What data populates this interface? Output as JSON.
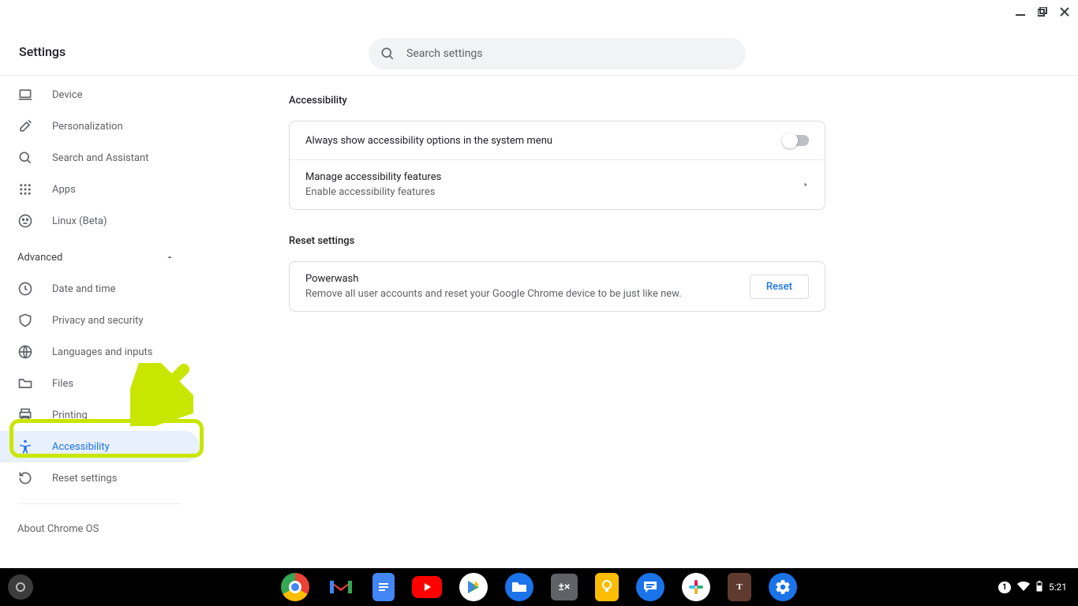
{
  "window": {
    "title": "Settings"
  },
  "search": {
    "placeholder": "Search settings"
  },
  "sidebar": {
    "main_items": [
      {
        "icon": "laptop",
        "label": "Device"
      },
      {
        "icon": "brush",
        "label": "Personalization"
      },
      {
        "icon": "search",
        "label": "Search and Assistant"
      },
      {
        "icon": "apps",
        "label": "Apps"
      },
      {
        "icon": "linux",
        "label": "Linux (Beta)"
      }
    ],
    "advanced_label": "Advanced",
    "advanced_items": [
      {
        "icon": "clock",
        "label": "Date and time"
      },
      {
        "icon": "shield",
        "label": "Privacy and security"
      },
      {
        "icon": "globe",
        "label": "Languages and inputs"
      },
      {
        "icon": "folder",
        "label": "Files"
      },
      {
        "icon": "print",
        "label": "Printing"
      },
      {
        "icon": "accessibility",
        "label": "Accessibility",
        "active": true
      },
      {
        "icon": "reset",
        "label": "Reset settings"
      }
    ],
    "about_label": "About Chrome OS"
  },
  "content": {
    "accessibility_title": "Accessibility",
    "always_show_label": "Always show accessibility options in the system menu",
    "manage_label": "Manage accessibility features",
    "manage_sub": "Enable accessibility features",
    "reset_title": "Reset settings",
    "powerwash_label": "Powerwash",
    "powerwash_sub": "Remove all user accounts and reset your Google Chrome device to be just like new.",
    "reset_button": "Reset"
  },
  "shelf": {
    "apps": [
      {
        "name": "Chrome",
        "color": "#fff"
      },
      {
        "name": "Gmail",
        "color": "#ea4335"
      },
      {
        "name": "Docs",
        "color": "#4285f4"
      },
      {
        "name": "YouTube",
        "color": "#ff0000"
      },
      {
        "name": "Play Store",
        "color": "#34a853"
      },
      {
        "name": "Files",
        "color": "#1a73e8"
      },
      {
        "name": "Calculator",
        "color": "#5f6368"
      },
      {
        "name": "Keep",
        "color": "#fbbc04"
      },
      {
        "name": "Messages",
        "color": "#1a73e8"
      },
      {
        "name": "Slack",
        "color": "#611f69"
      },
      {
        "name": "Text",
        "color": "#5f3b2f"
      },
      {
        "name": "Settings",
        "color": "#1a73e8"
      }
    ],
    "notification_count": "1",
    "time": "5:21"
  }
}
